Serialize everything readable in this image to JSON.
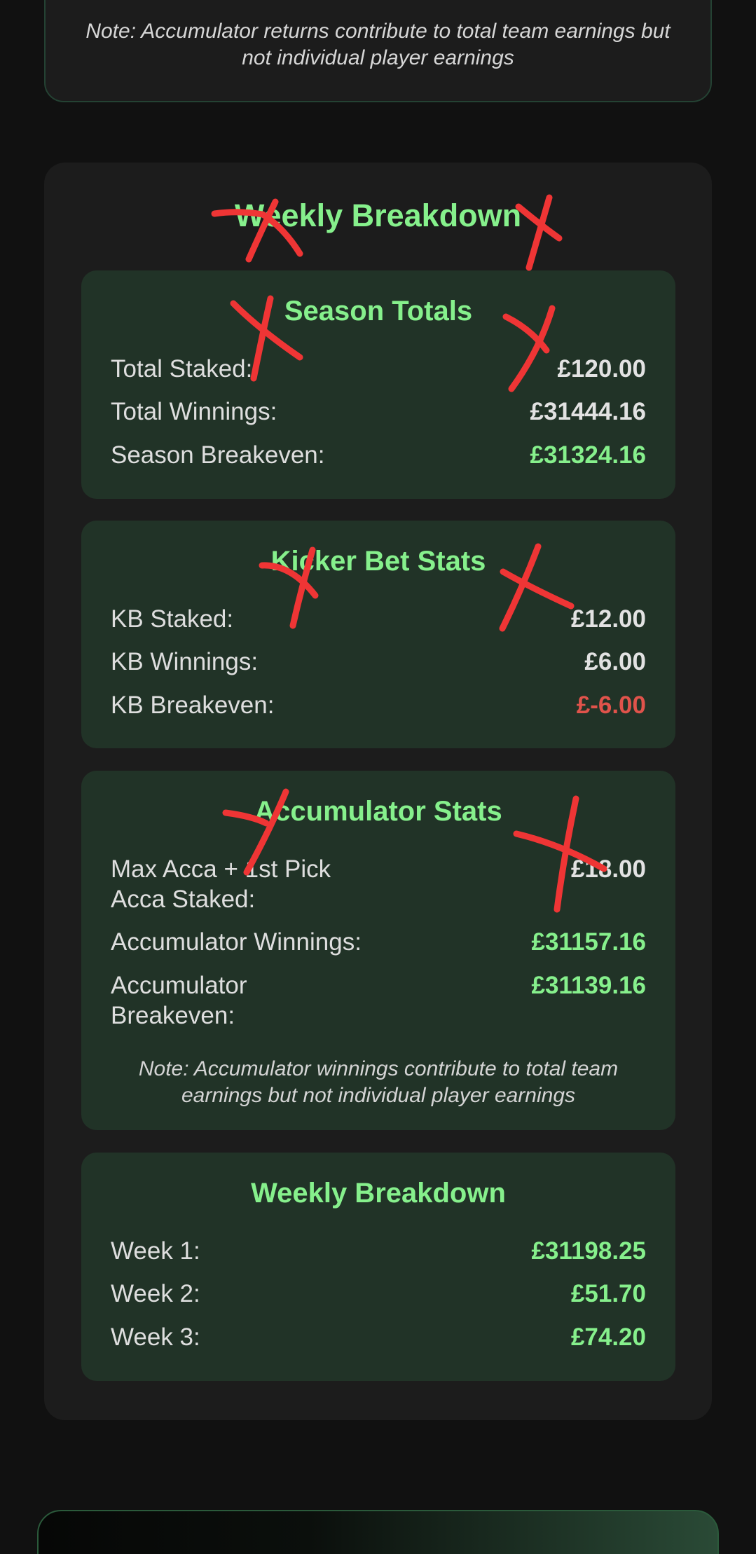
{
  "top_note": "Note: Accumulator returns contribute to total team earnings but not individual player earnings",
  "main_title": "Weekly Breakdown",
  "season_totals": {
    "title": "Season Totals",
    "rows": [
      {
        "label": "Total Staked:",
        "value": "£120.00"
      },
      {
        "label": "Total Winnings:",
        "value": "£31444.16"
      },
      {
        "label": "Season Breakeven:",
        "value": "£31324.16"
      }
    ]
  },
  "kicker_bet_stats": {
    "title": "Kicker Bet Stats",
    "rows": [
      {
        "label": "KB Staked:",
        "value": "£12.00"
      },
      {
        "label": "KB Winnings:",
        "value": "£6.00"
      },
      {
        "label": "KB Breakeven:",
        "value": "£-6.00"
      }
    ]
  },
  "accumulator_stats": {
    "title": "Accumulator Stats",
    "rows": [
      {
        "label": "Max Acca + 1st Pick Acca Staked:",
        "value": "£18.00"
      },
      {
        "label": "Accumulator Winnings:",
        "value": "£31157.16"
      },
      {
        "label": "Accumulator Breakeven:",
        "value": "£31139.16"
      }
    ],
    "note": "Note: Accumulator winnings contribute to total team earnings but not individual player earnings"
  },
  "weekly_breakdown": {
    "title": "Weekly Breakdown",
    "rows": [
      {
        "label": "Week 1:",
        "value": "£31198.25"
      },
      {
        "label": "Week 2:",
        "value": "£51.70"
      },
      {
        "label": "Week 3:",
        "value": "£74.20"
      }
    ]
  },
  "colors": {
    "background": "#111111",
    "card": "#1c1c1c",
    "inner_card": "#213327",
    "accent_green": "#86f08c",
    "negative_red": "#e0534b",
    "annotation_red": "#ef3535"
  }
}
